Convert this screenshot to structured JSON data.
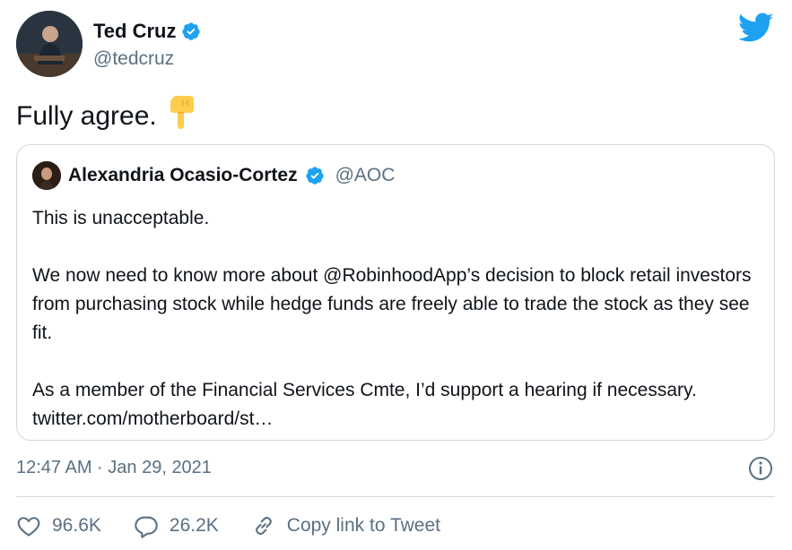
{
  "author": {
    "display_name": "Ted Cruz",
    "handle": "@tedcruz",
    "verified_icon": "verified-badge-icon",
    "avatar": "avatar"
  },
  "brand": {
    "logo_icon": "twitter-bird-icon",
    "accent": "#1da1f2"
  },
  "tweet": {
    "text": "Fully agree.",
    "emoji": "👇"
  },
  "quoted_tweet": {
    "display_name": "Alexandria Ocasio-Cortez",
    "handle": "@AOC",
    "paragraphs": [
      "This is unacceptable.",
      "We now need to know more about @RobinhoodApp’s decision to block retail investors from purchasing stock while hedge funds are freely able to trade the stock as they see fit.",
      "As a member of the Financial Services Cmte, I’d support a hearing if necessary. twitter.com/motherboard/st…"
    ]
  },
  "meta": {
    "timestamp": "12:47 AM · Jan 29, 2021",
    "info_icon": "info-icon"
  },
  "actions": {
    "likes": "96.6K",
    "replies": "26.2K",
    "copy_link": "Copy link to Tweet"
  },
  "colors": {
    "text_primary": "#0f1419",
    "text_secondary": "#5b7083",
    "border": "#cfd9de",
    "verified": "#1da1f2"
  }
}
